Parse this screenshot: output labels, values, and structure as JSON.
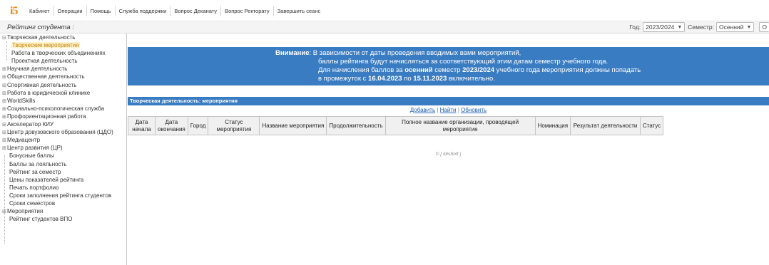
{
  "logo": "i5",
  "menu": [
    "Кабинет",
    "Операции",
    "Помощь",
    "Служба поддержки",
    "Вопрос Деканату",
    "Вопрос Ректорату",
    "Завершить сеанс"
  ],
  "page_title": "Рейтинг студента :",
  "period": {
    "year_label": "Год:",
    "year_value": "2023/2024",
    "semester_label": "Семестр:",
    "semester_value": "Осенний",
    "extra_value": "О"
  },
  "sidebar": [
    {
      "label": "Творческая деятельность",
      "level": 0,
      "pm": "⊟"
    },
    {
      "label": "Творческие мероприятия",
      "level": 1,
      "selected": true
    },
    {
      "label": "Работа в творческих объединениях",
      "level": 1
    },
    {
      "label": "Проектная деятельность",
      "level": 1
    },
    {
      "label": "Научная деятельность",
      "level": 0,
      "pm": "⊞"
    },
    {
      "label": "Общественная деятельность",
      "level": 0,
      "pm": "⊞"
    },
    {
      "label": "Спортивная деятельность",
      "level": 0,
      "pm": "⊞"
    },
    {
      "label": "Работа в юридической клинике",
      "level": 0,
      "pm": "⊞"
    },
    {
      "label": "WorldSkills",
      "level": 0,
      "pm": "⊞"
    },
    {
      "label": "Социально-психологическая служба",
      "level": 0,
      "pm": "⊞"
    },
    {
      "label": "Профориентационная работа",
      "level": 0,
      "pm": "⊞"
    },
    {
      "label": "Акселератор КИУ",
      "level": 0,
      "pm": "⊞"
    },
    {
      "label": "Центр довузовского образования (ЦДО)",
      "level": 0,
      "pm": "⊞"
    },
    {
      "label": "Медиацентр",
      "level": 0,
      "pm": "⊞"
    },
    {
      "label": "Центр развития (ЦР)",
      "level": 0,
      "pm": "⊞"
    },
    {
      "label": "Бонусные баллы",
      "level": 2
    },
    {
      "label": "Баллы за лояльность",
      "level": 2
    },
    {
      "label": "Рейтинг за семестр",
      "level": 2
    },
    {
      "label": "Цены показателей рейтинга",
      "level": 2
    },
    {
      "label": "Печать портфолио",
      "level": 2
    },
    {
      "label": "Сроки заполнения рейтинга студентов",
      "level": 2
    },
    {
      "label": "Сроки семестров",
      "level": 2
    },
    {
      "label": "Мероприятия",
      "level": 0,
      "pm": "⊞"
    },
    {
      "label": "Рейтинг студентов ВПО",
      "level": 2
    }
  ],
  "notice": {
    "prefix": "Внимание",
    "line1": ": В зависимости от даты проведения вводимых вами мероприятий,",
    "line2": "баллы рейтинга будут начисляться за соответствующий этим датам семестр учебного года.",
    "line3_a": "Для начисления баллов за ",
    "line3_sem": "осенний",
    "line3_b": " семестр ",
    "line3_year": "2023/2024",
    "line3_c": " учебного года мероприятия должны попадать",
    "line4_a": "в промежуток с ",
    "line4_from": "16.04.2023",
    "line4_b": " по ",
    "line4_to": "15.11.2023",
    "line4_c": " включительно."
  },
  "section_title": "Творческая деятельность: мероприятия",
  "actions": {
    "add": "Добавить",
    "find": "Найти",
    "refresh": "Обновить",
    "sep": " | "
  },
  "table_headers": [
    "Дата начала",
    "Дата окончания",
    "Город",
    "Статус мероприятия",
    "Название мероприятия",
    "Продолжительность",
    "Полное название организации, проводящей мероприятие",
    "Номинация",
    "Результат деятельности",
    "Статус"
  ],
  "footer": "© [ IdisSoft ]"
}
